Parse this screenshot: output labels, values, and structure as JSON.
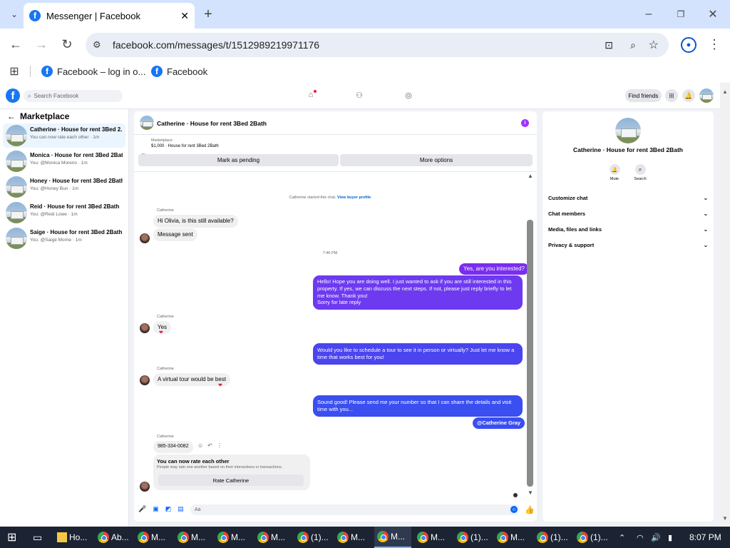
{
  "browser": {
    "tab_title": "Messenger | Facebook",
    "url": "facebook.com/messages/t/1512989219971176",
    "bookmarks": [
      "Facebook – log in o...",
      "Facebook"
    ]
  },
  "fb": {
    "search_placeholder": "Search Facebook",
    "find_friends": "Find friends"
  },
  "marketplace": {
    "heading": "Marketplace",
    "conversations": [
      {
        "title": "Catherine · House for rent 3Bed 2...",
        "snippet": "You can now rate each other · 1m"
      },
      {
        "title": "Monica · House for rent 3Bed 2Bath",
        "snippet": "You: @Monica Moreno · 1m"
      },
      {
        "title": "Honey · House for rent 3Bed 2Bath",
        "snippet": "You: @Honey Bun · 1m"
      },
      {
        "title": "Reid · House for rent 3Bed 2Bath",
        "snippet": "You: @Reid Lowe · 1m"
      },
      {
        "title": "Saige · House for rent 3Bed 2Bath",
        "snippet": "You: @Saige Morrie · 1m"
      }
    ]
  },
  "chat": {
    "header_title": "Catherine · House for rent 3Bed 2Bath",
    "listing_label": "Marketplace",
    "listing_detail": "$1,000 · House for rent 3Bed 2Bath",
    "mark_pending": "Mark as pending",
    "more_options": "More options",
    "started_text": "Catherine started this chat.",
    "view_profile": "View buyer profile",
    "sender_name": "Catherine",
    "msg1": "Hi Olivia, is this still available?",
    "msg2": "Message sent",
    "time1": "7:46 PM",
    "out1": "Yes, are you interested?",
    "out2": "Hello! Hope you are doing well. I just wanted to ask if you are still interested in this property. If yes, we can discuss the next steps. If not, please just reply briefly to let me know. Thank you!",
    "out2b": "Sorry for late reply",
    "msg3": "Yes",
    "out3": "Would you like to schedule a tour to see it in person or virtually? Just let me know a time that works best for you!",
    "msg4": "A virtual tour would be best",
    "out4": "Sound good! Please send me your number so that I can share the details and visit time with you...",
    "out5": "@Catherine Gray",
    "phone": "985-334-0082",
    "rate_title": "You can now rate each other",
    "rate_desc": "People may rate one another based on their interactions or transactions.",
    "rate_button": "Rate Catherine",
    "composer_placeholder": "Aa"
  },
  "info": {
    "title": "Catherine · House for rent 3Bed 2Bath",
    "mute": "Mute",
    "search": "Search",
    "sections": [
      "Customize chat",
      "Chat members",
      "Media, files and links",
      "Privacy & support"
    ]
  },
  "taskbar": {
    "items": [
      "Ho...",
      "Ab...",
      "M...",
      "M...",
      "M...",
      "M...",
      "(1)...",
      "M...",
      "M...",
      "M...",
      "(1)...",
      "M...",
      "(1)...",
      "(1)..."
    ],
    "clock": "8:07 PM"
  },
  "colors": {
    "accent": "#1877f2",
    "bubble_purple": "#7a2cf2",
    "bubble_blue": "#3b4ef0"
  }
}
